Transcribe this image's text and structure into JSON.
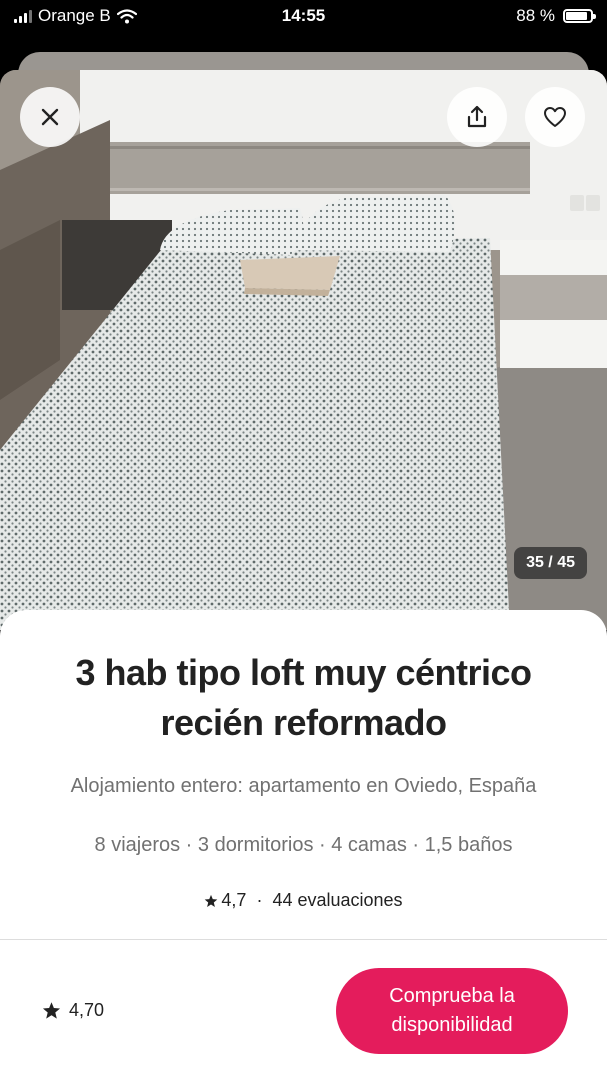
{
  "status_bar": {
    "carrier": "Orange B",
    "time": "14:55",
    "battery": "88 %",
    "battery_level": 0.88
  },
  "gallery": {
    "counter": "35 / 45",
    "close_icon": "close-icon",
    "share_icon": "share-icon",
    "favorite_icon": "heart-icon"
  },
  "listing": {
    "title": "3 hab  tipo loft muy céntrico recién reformado",
    "subtitle": "Alojamiento entero: apartamento en Oviedo, España",
    "details": "8 viajeros · 3 dormitorios · 4 camas · 1,5 baños",
    "rating": "4,7",
    "reviews": "44 evaluaciones",
    "separator": "·"
  },
  "footer": {
    "rating": "4,70",
    "cta_label": "Comprueba la disponibilidad"
  },
  "colors": {
    "accent": "#E41C5C",
    "text": "#222222",
    "muted": "#717171"
  }
}
